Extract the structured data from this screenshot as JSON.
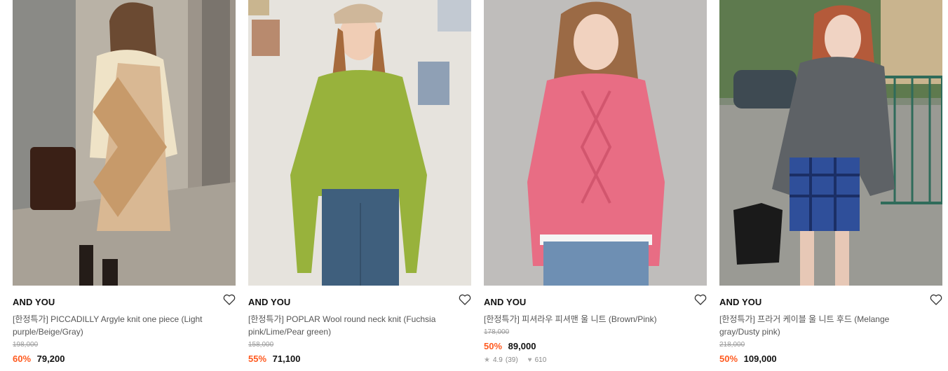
{
  "products": [
    {
      "brand": "AND YOU",
      "title": "[한정특가] PICCADILLY Argyle knit one piece (Light purple/Beige/Gray)",
      "original_price": "198,000",
      "discount": "60%",
      "price": "79,200",
      "colors": {
        "bg": "#b9b2a6",
        "garment": "#d9b893",
        "accent": "#f1e6cc"
      }
    },
    {
      "brand": "AND YOU",
      "title": "[한정특가] POPLAR Wool round neck knit (Fuchsia pink/Lime/Pear green)",
      "original_price": "158,000",
      "discount": "55%",
      "price": "71,100",
      "colors": {
        "bg": "#e6e3dd",
        "garment": "#98b23c",
        "accent": "#3f5f7d"
      }
    },
    {
      "brand": "AND YOU",
      "title": "[한정특가] 피셔라우 피셔맨 울 니트 (Brown/Pink)",
      "original_price": "178,000",
      "discount": "50%",
      "price": "89,000",
      "rating": "4.9",
      "review_count": "(39)",
      "likes": "610",
      "colors": {
        "bg": "#bfbdbb",
        "garment": "#e86d84",
        "accent": "#6e8fb3"
      }
    },
    {
      "brand": "AND YOU",
      "title": "[한정특가] 프라거 케이블 울 니트 후드 (Melange gray/Dusty pink)",
      "original_price": "218,000",
      "discount": "50%",
      "price": "109,000",
      "colors": {
        "bg": "#7f8a78",
        "garment": "#5e6266",
        "accent": "#2f4f9a"
      }
    }
  ],
  "icons": {
    "wishlist": "heart-outline-icon",
    "rating": "star-icon",
    "likes": "heart-filled-icon"
  },
  "accent_color": "#ff5a1f"
}
